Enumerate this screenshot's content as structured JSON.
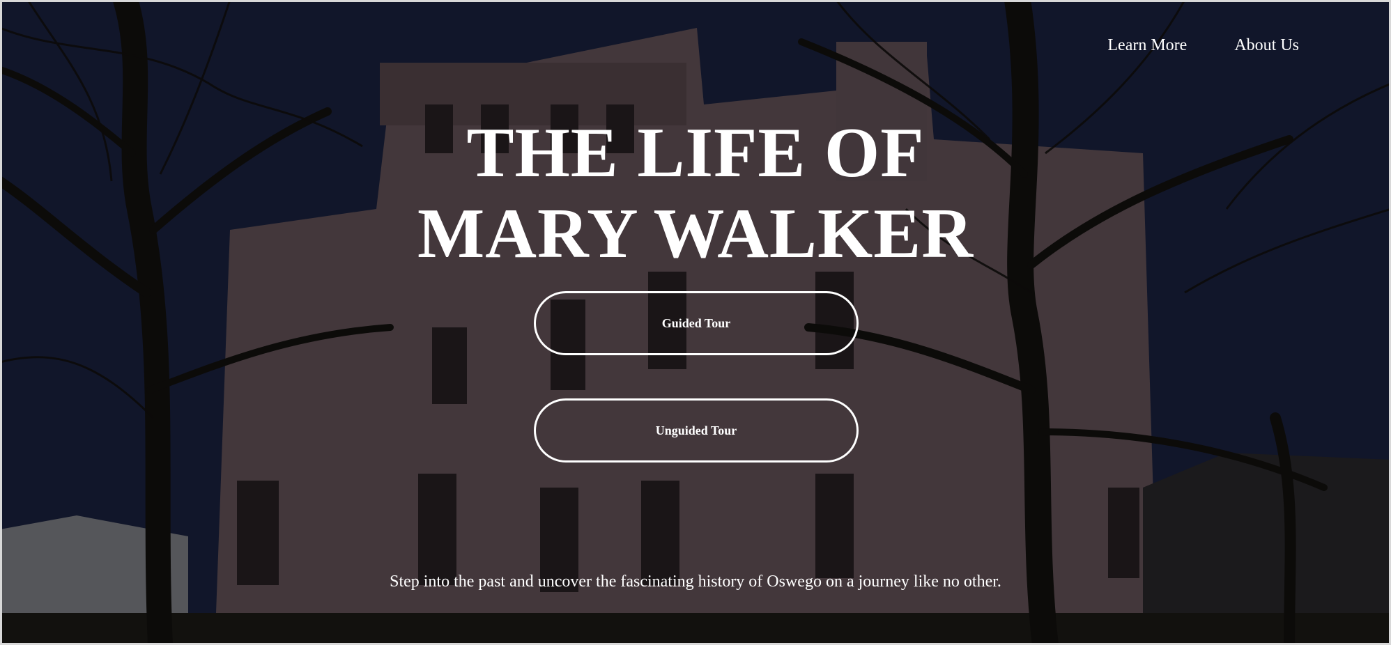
{
  "nav": {
    "learn_more": "Learn More",
    "about_us": "About Us"
  },
  "hero": {
    "title_line1": "THE LIFE OF",
    "title_line2": "MARY WALKER",
    "guided_tour_label": "Guided Tour",
    "unguided_tour_label": "Unguided Tour",
    "tagline": "Step into the past and uncover the fascinating history of Oswego on a journey like no other."
  },
  "colors": {
    "text": "#ffffff",
    "sky": "#1a2446",
    "building": "#6e5a60",
    "overlay": "rgba(0,0,0,0.38)"
  }
}
